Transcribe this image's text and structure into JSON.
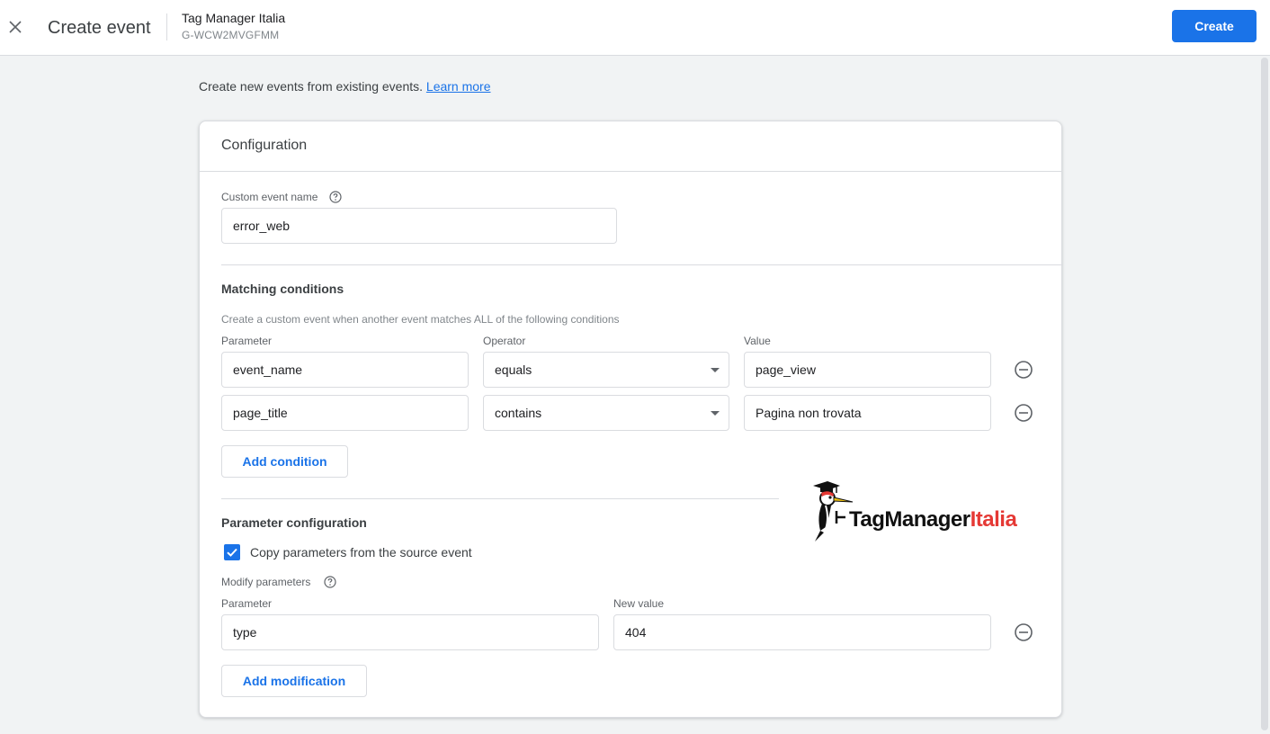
{
  "header": {
    "title": "Create event",
    "property_name": "Tag Manager Italia",
    "property_id": "G-WCW2MVGFMM",
    "create_label": "Create"
  },
  "intro": {
    "text": "Create new events from existing events.",
    "link_label": "Learn more"
  },
  "configuration": {
    "title": "Configuration",
    "custom_event_name_label": "Custom event name",
    "custom_event_name_value": "error_web"
  },
  "matching": {
    "title": "Matching conditions",
    "hint": "Create a custom event when another event matches ALL of the following conditions",
    "headers": {
      "parameter": "Parameter",
      "operator": "Operator",
      "value": "Value"
    },
    "conditions": [
      {
        "parameter": "event_name",
        "operator": "equals",
        "value": "page_view"
      },
      {
        "parameter": "page_title",
        "operator": "contains",
        "value": "Pagina non trovata"
      }
    ],
    "add_label": "Add condition"
  },
  "param_config": {
    "title": "Parameter configuration",
    "copy_label": "Copy parameters from the source event",
    "copy_checked": true,
    "modify_label": "Modify parameters",
    "headers": {
      "parameter": "Parameter",
      "new_value": "New value"
    },
    "modifications": [
      {
        "parameter": "type",
        "new_value": "404"
      }
    ],
    "add_label": "Add modification"
  },
  "logo": {
    "part1": "TagManager",
    "part2": "Italia",
    "color1": "#111111",
    "color2": "#e53935"
  },
  "colors": {
    "accent": "#1a73e8",
    "border": "#dadce0",
    "background": "#f1f3f4"
  }
}
